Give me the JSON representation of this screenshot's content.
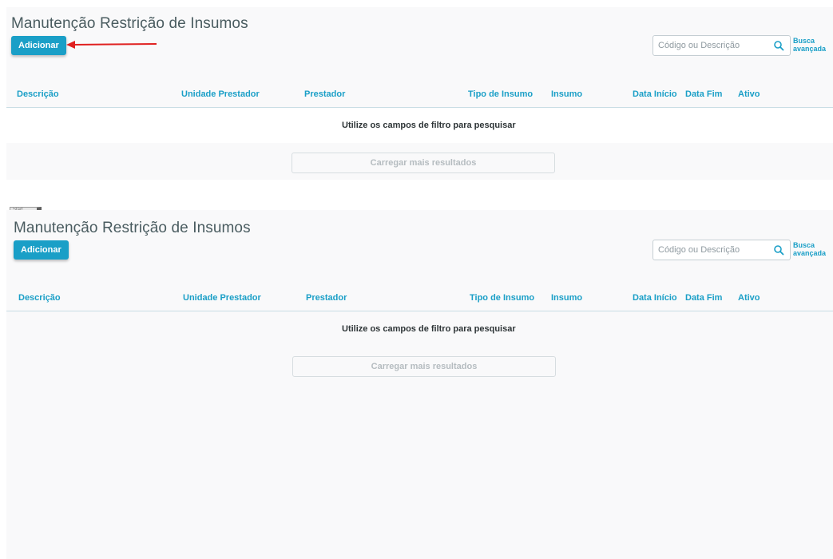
{
  "top": {
    "title": "Manutenção Restrição de Insumos",
    "add_label": "Adicionar",
    "search_placeholder": "Código ou Descrição",
    "advanced_line1": "Busca",
    "advanced_line2": "avançada",
    "columns": [
      "Descrição",
      "Unidade Prestador",
      "Prestador",
      "Tipo de Insumo",
      "Insumo",
      "Data Início",
      "Data Fim",
      "Ativo"
    ],
    "empty_message": "Utilize os campos de filtro para pesquisar",
    "load_more_label": "Carregar mais resultados"
  },
  "bottom": {
    "start_tag": "Start",
    "title": "Manutenção Restrição de Insumos",
    "add_label": "Adicionar",
    "search_placeholder": "Código ou Descrição",
    "advanced_line1": "Busca",
    "advanced_line2": "avançada",
    "columns": [
      "Descrição",
      "Unidade Prestador",
      "Prestador",
      "Tipo de Insumo",
      "Insumo",
      "Data Início",
      "Data Fim",
      "Ativo"
    ],
    "empty_message": "Utilize os campos de filtro para pesquisar",
    "load_more_label": "Carregar mais resultados"
  },
  "colors": {
    "accent": "#1a9fc7",
    "annotation_arrow": "#e0201f",
    "panel_bg": "#f9f9fa"
  }
}
